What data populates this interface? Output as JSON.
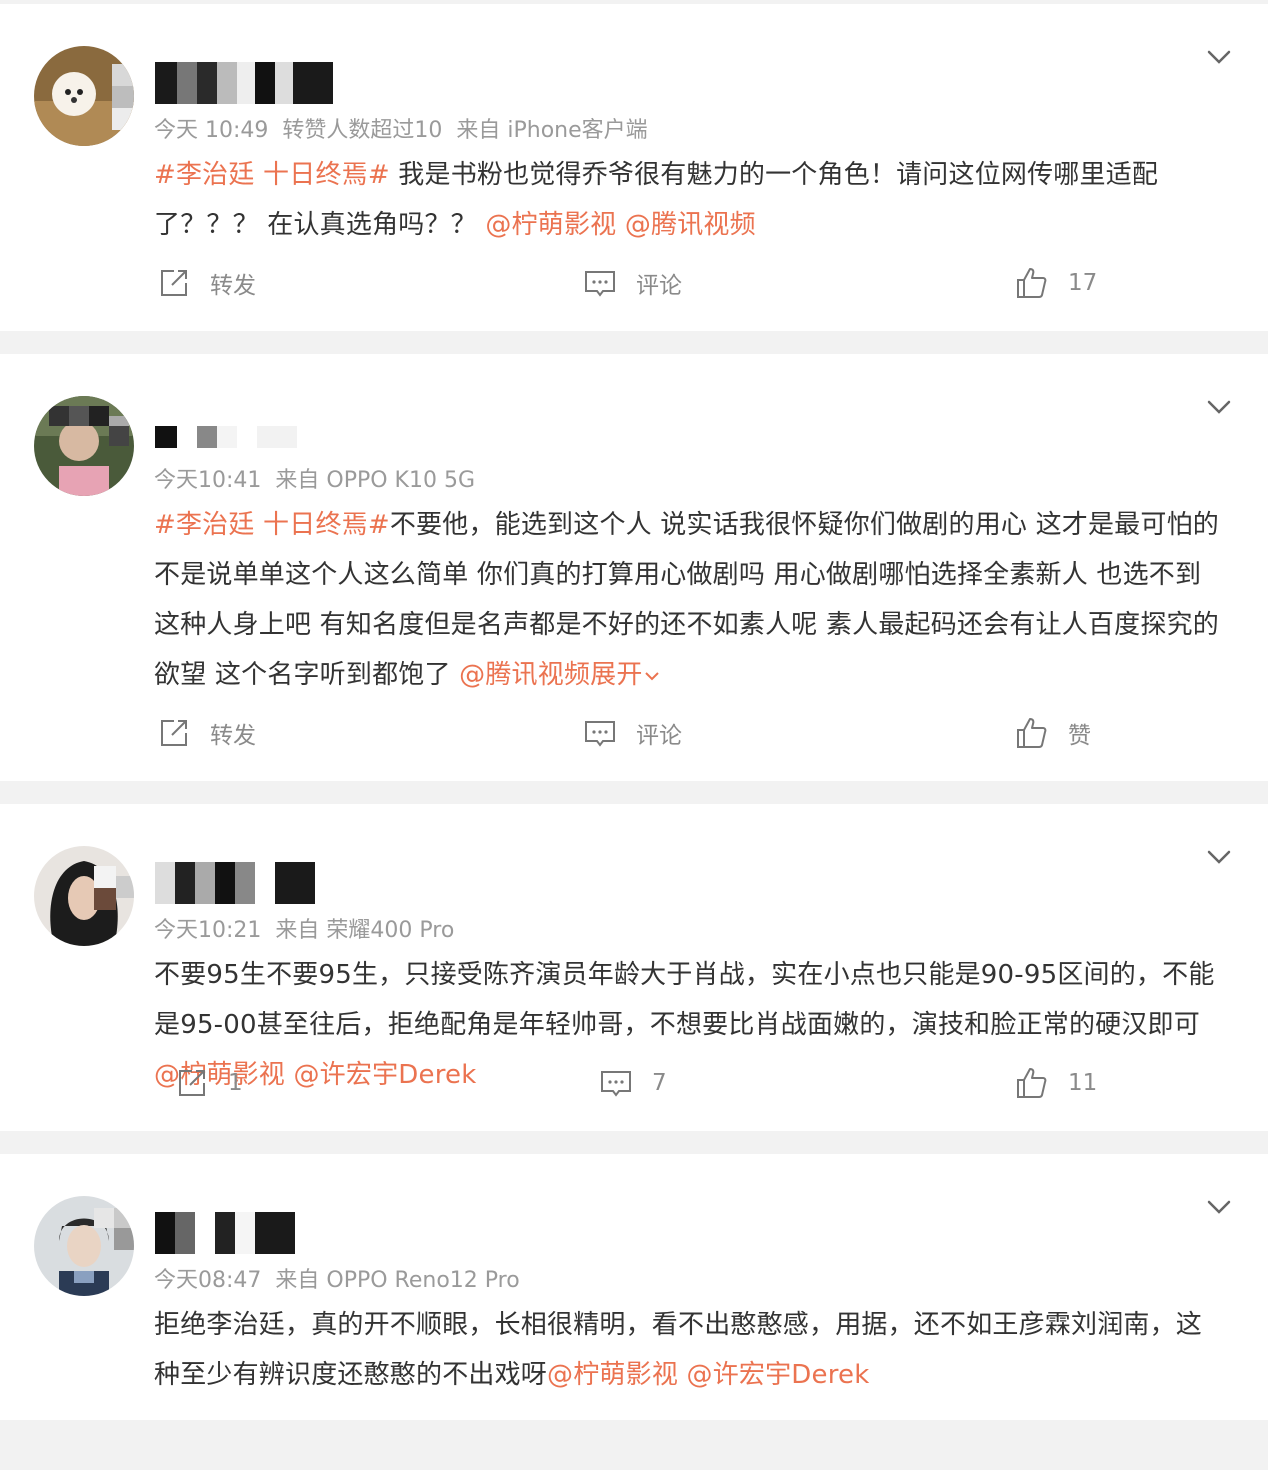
{
  "posts": [
    {
      "meta": {
        "time": "今天 10:49",
        "extra": "转赞人数超过10",
        "source": "来自 iPhone客户端"
      },
      "content": [
        {
          "t": "tag",
          "v": "#李治廷 十日终焉#"
        },
        {
          "t": "text",
          "v": " 我是书粉也觉得乔爷很有魅力的一个角色！请问这位网传哪里适配了？？？ 在认真选角吗？？ "
        },
        {
          "t": "at",
          "v": "@柠萌影视"
        },
        {
          "t": "text",
          "v": " "
        },
        {
          "t": "at",
          "v": "@腾讯视频"
        }
      ],
      "actions": {
        "repost": "转发",
        "comment": "评论",
        "like": "17"
      }
    },
    {
      "meta": {
        "time": "今天10:41",
        "source": "来自 OPPO K10 5G"
      },
      "content": [
        {
          "t": "tag",
          "v": "#李治廷 十日终焉#"
        },
        {
          "t": "text",
          "v": "不要他，能选到这个人 说实话我很怀疑你们做剧的用心 这才是最可怕的 不是说单单这个人这么简单 你们真的打算用心做剧吗 用心做剧哪怕选择全素新人 也选不到这种人身上吧 有知名度但是名声都是不好的还不如素人呢 素人最起码还会有让人百度探究的欲望 这个名字听到都饱了 "
        },
        {
          "t": "at",
          "v": "@腾讯视频"
        }
      ],
      "expand": "展开",
      "actions": {
        "repost": "转发",
        "comment": "评论",
        "like": "赞"
      }
    },
    {
      "meta": {
        "time": "今天10:21",
        "source": "来自 荣耀400 Pro"
      },
      "content": [
        {
          "t": "text",
          "v": "不要95生不要95生，只接受陈齐演员年龄大于肖战，实在小点也只能是90-95区间的，不能是95-00甚至往后，拒绝配角是年轻帅哥，不想要比肖战面嫩的，演技和脸正常的硬汉即可"
        },
        {
          "t": "at",
          "v": "@柠萌影视"
        },
        {
          "t": "text",
          "v": " "
        },
        {
          "t": "at",
          "v": "@许宏宇Derek"
        }
      ],
      "actions": {
        "repost": "1",
        "comment": "7",
        "like": "11"
      }
    },
    {
      "meta": {
        "time": "今天08:47",
        "source": "来自 OPPO Reno12 Pro"
      },
      "content": [
        {
          "t": "text",
          "v": "拒绝李治廷，真的开不顺眼，长相很精明，看不出憨憨感，用据，还不如王彦霖刘润南，这种至少有辨识度还憨憨的不出戏呀"
        },
        {
          "t": "at",
          "v": "@柠萌影视"
        },
        {
          "t": "text",
          "v": " "
        },
        {
          "t": "at",
          "v": "@许宏宇Derek"
        }
      ]
    }
  ],
  "icons": {
    "repost": "share-icon",
    "comment": "comment-icon",
    "like": "thumbs-up-icon",
    "menu": "chevron-down-icon"
  },
  "colors": {
    "accent": "#eb7350",
    "meta": "#9a9a9a",
    "text": "#333333",
    "background": "#f2f2f2"
  }
}
